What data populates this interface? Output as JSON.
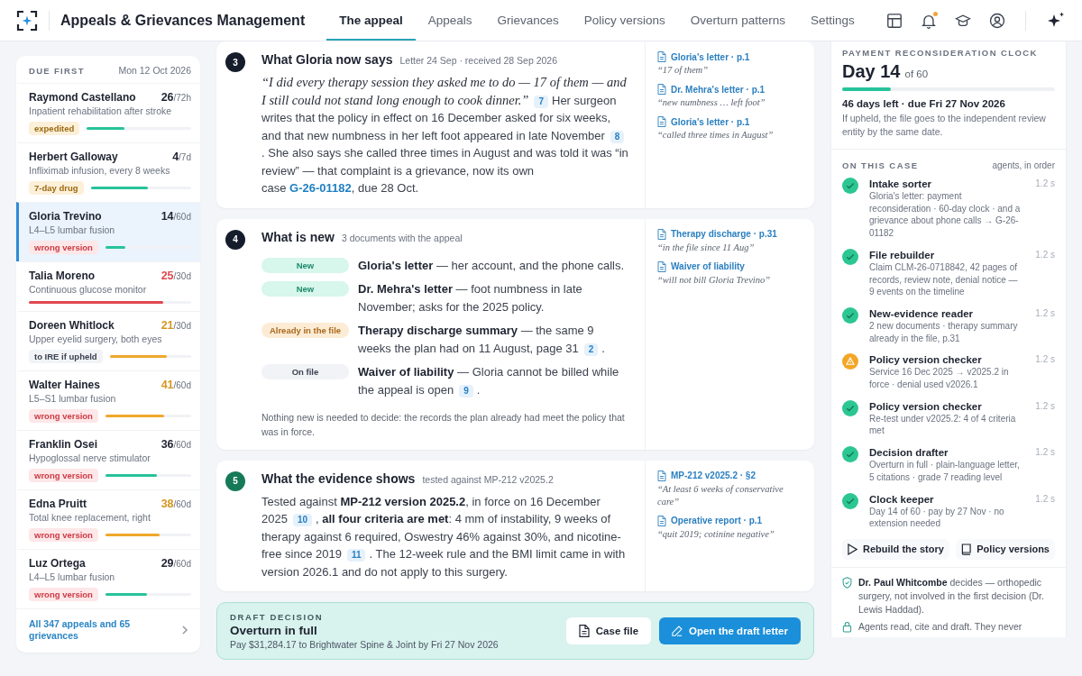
{
  "app": {
    "title": "Appeals & Grievances Management"
  },
  "tabs": [
    {
      "label": "The appeal",
      "selected": true
    },
    {
      "label": "Appeals",
      "selected": false
    },
    {
      "label": "Grievances",
      "selected": false
    },
    {
      "label": "Policy versions",
      "selected": false
    },
    {
      "label": "Overturn patterns",
      "selected": false
    },
    {
      "label": "Settings",
      "selected": false
    }
  ],
  "notifications": {
    "unread": true
  },
  "queue": {
    "heading": "DUE FIRST",
    "date": "Mon 12 Oct 2026",
    "items": [
      {
        "name": "Raymond Castellano",
        "service": "Inpatient rehabilitation after stroke",
        "elapsed": "26",
        "limit": "/72h",
        "kind": "normal",
        "tag": {
          "text": "expedited",
          "kind": "warning"
        },
        "level": 0.36,
        "selected": false
      },
      {
        "name": "Herbert Galloway",
        "service": "Infliximab infusion, every 8 weeks",
        "elapsed": "4",
        "limit": "/7d",
        "kind": "normal",
        "tag": {
          "text": "7-day drug",
          "kind": "warning"
        },
        "level": 0.57,
        "selected": false
      },
      {
        "name": "Gloria Trevino",
        "service": "L4–L5 lumbar fusion",
        "elapsed": "14",
        "limit": "/60d",
        "kind": "normal",
        "tag": {
          "text": "wrong version",
          "kind": "danger"
        },
        "level": 0.23,
        "selected": true
      },
      {
        "name": "Talia Moreno",
        "service": "Continuous glucose monitor",
        "elapsed": "25",
        "limit": "/30d",
        "kind": "critical",
        "level": 0.83,
        "selected": false
      },
      {
        "name": "Doreen Whitlock",
        "service": "Upper eyelid surgery, both eyes",
        "elapsed": "21",
        "limit": "/30d",
        "kind": "warning",
        "tag": {
          "text": "to IRE if upheld",
          "kind": "neutral"
        },
        "level": 0.7,
        "selected": false
      },
      {
        "name": "Walter Haines",
        "service": "L5–S1 lumbar fusion",
        "elapsed": "41",
        "limit": "/60d",
        "kind": "warning",
        "tag": {
          "text": "wrong version",
          "kind": "danger"
        },
        "level": 0.68,
        "selected": false
      },
      {
        "name": "Franklin Osei",
        "service": "Hypoglossal nerve stimulator",
        "elapsed": "36",
        "limit": "/60d",
        "kind": "normal",
        "tag": {
          "text": "wrong version",
          "kind": "danger"
        },
        "level": 0.6,
        "selected": false
      },
      {
        "name": "Edna Pruitt",
        "service": "Total knee replacement, right",
        "elapsed": "38",
        "limit": "/60d",
        "kind": "warning",
        "tag": {
          "text": "wrong version",
          "kind": "danger"
        },
        "level": 0.63,
        "selected": false
      },
      {
        "name": "Luz Ortega",
        "service": "L4–L5 lumbar fusion",
        "elapsed": "29",
        "limit": "/60d",
        "kind": "normal",
        "tag": {
          "text": "wrong version",
          "kind": "danger"
        },
        "level": 0.48,
        "selected": false
      }
    ],
    "footer_link": "All 347 appeals and 65 grievances"
  },
  "cards": [
    {
      "number": "3",
      "done": false,
      "title": "What Gloria now says",
      "meta": "Letter 24 Sep · received 28 Sep 2026",
      "body": [
        {
          "kind": "quote",
          "text": "“I did every therapy session they asked me to do — 17 of them — and I still could not stand long enough to cook dinner.”"
        },
        {
          "kind": "cite",
          "text": "7"
        },
        {
          "kind": "text",
          "text": "Her surgeon writes that the policy in effect on 16 December asked for six weeks, and that new numbness in her left foot appeared in late November"
        },
        {
          "kind": "cite",
          "text": "8"
        },
        {
          "kind": "text",
          "text": ". She also says she called three times in August and was told it was “in review” — that complaint is a grievance, now its own case"
        },
        {
          "kind": "link",
          "text": "G-26-01182"
        },
        {
          "kind": "text",
          "text": ", due 28 Oct."
        }
      ],
      "sources": [
        {
          "label": "Gloria's letter · p.1",
          "quote": "“17 of them”"
        },
        {
          "label": "Dr. Mehra's letter · p.1",
          "quote": "“new numbness … left foot”"
        },
        {
          "label": "Gloria's letter · p.1",
          "quote": "“called three times in August”"
        }
      ]
    },
    {
      "number": "4",
      "done": false,
      "title": "What is new",
      "meta": "3 documents with the appeal",
      "documents": [
        {
          "status": "New",
          "kind": "new",
          "body": [
            {
              "kind": "text",
              "text": "**Gloria's letter** — her account, and the phone calls."
            }
          ]
        },
        {
          "status": "New",
          "kind": "new",
          "body": [
            {
              "kind": "text",
              "text": "**Dr. Mehra's letter** — foot numbness in late November; asks for the 2025 policy."
            }
          ]
        },
        {
          "status": "Already in the file",
          "kind": "existing",
          "body": [
            {
              "kind": "text",
              "text": "**Therapy discharge summary** — the same 9 weeks the plan had on 11 August, page 31"
            },
            {
              "kind": "cite",
              "text": "2"
            },
            {
              "kind": "text",
              "text": "."
            }
          ]
        },
        {
          "status": "On file",
          "kind": "on_file",
          "body": [
            {
              "kind": "text",
              "text": "**Waiver of liability** — Gloria cannot be billed while the appeal is open"
            },
            {
              "kind": "cite",
              "text": "9"
            },
            {
              "kind": "text",
              "text": "."
            }
          ]
        }
      ],
      "note": "Nothing new is needed to decide: the records the plan already had meet the policy that was in force.",
      "sources": [
        {
          "label": "Therapy discharge · p.31",
          "quote": "“in the file since 11 Aug”"
        },
        {
          "label": "Waiver of liability",
          "quote": "“will not bill Gloria Trevino”"
        }
      ]
    },
    {
      "number": "5",
      "done": true,
      "title": "What the evidence shows",
      "meta": "tested against MP-212 v2025.2",
      "body": [
        {
          "kind": "text",
          "text": "Tested against **MP-212 version 2025.2**, in force on 16 December 2025"
        },
        {
          "kind": "cite",
          "text": "10"
        },
        {
          "kind": "text",
          "text": ", **all four criteria are met**: 4 mm of instability, 9 weeks of therapy against 6 required, Oswestry 46% against 30%, and nicotine-free since 2019"
        },
        {
          "kind": "cite",
          "text": "11"
        },
        {
          "kind": "text",
          "text": ". The 12-week rule and the BMI limit came in with version 2026.1 and do not apply to this surgery."
        }
      ],
      "sources": [
        {
          "label": "MP-212 v2025.2 · §2",
          "quote": "“At least 6 weeks of conservative care”"
        },
        {
          "label": "Operative report · p.1",
          "quote": "“quit 2019; cotinine negative”"
        }
      ]
    }
  ],
  "decision": {
    "heading": "DRAFT DECISION",
    "title": "Overturn in full",
    "detail": "Pay $31,284.17 to Brightwater Spine & Joint by Fri 27 Nov 2026",
    "buttons": [
      {
        "label": "Case file",
        "kind": "secondary"
      },
      {
        "label": "Open the draft letter",
        "kind": "primary"
      }
    ]
  },
  "clock": {
    "heading": "PAYMENT RECONSIDERATION CLOCK",
    "day": "Day 14",
    "total": "of 60",
    "level": 0.23,
    "remaining": "46 days left · due Fri 27 Nov 2026",
    "note": "If upheld, the file goes to the independent review entity by the same date."
  },
  "agents": {
    "heading": "ON THIS CASE",
    "order_note": "agents, in order",
    "items": [
      {
        "name": "Intake sorter",
        "detail": "Gloria's letter: payment reconsideration · 60-day clock · and a grievance about phone calls → G-26-01182",
        "time": "1.2 s",
        "kind": "done"
      },
      {
        "name": "File rebuilder",
        "detail": "Claim CLM-26-0718842, 42 pages of records, review note, denial notice — 9 events on the timeline",
        "time": "1.2 s",
        "kind": "done"
      },
      {
        "name": "New-evidence reader",
        "detail": "2 new documents · therapy summary already in the file, p.31",
        "time": "1.2 s",
        "kind": "done"
      },
      {
        "name": "Policy version checker",
        "detail": "Service 16 Dec 2025 → v2025.2 in force · denial used v2026.1",
        "time": "1.2 s",
        "kind": "warning"
      },
      {
        "name": "Policy version checker",
        "detail": "Re-test under v2025.2: 4 of 4 criteria met",
        "time": "1.2 s",
        "kind": "done"
      },
      {
        "name": "Decision drafter",
        "detail": "Overturn in full · plain-language letter, 5 citations · grade 7 reading level",
        "time": "1.2 s",
        "kind": "done"
      },
      {
        "name": "Clock keeper",
        "detail": "Day 14 of 60 · pay by 27 Nov · no extension needed",
        "time": "1.2 s",
        "kind": "done"
      }
    ],
    "actions": [
      {
        "label": "Rebuild the story",
        "kind": "rebuild"
      },
      {
        "label": "Policy versions",
        "kind": "policies"
      }
    ]
  },
  "notes": [
    {
      "kind": "reviewer",
      "text": "**Dr. Paul Whitcombe** decides — orthopedic surgery, not involved in the first decision (Dr. Lewis Haddad)."
    },
    {
      "kind": "safeguard",
      "text": "Agents read, cite and draft. They never"
    }
  ]
}
